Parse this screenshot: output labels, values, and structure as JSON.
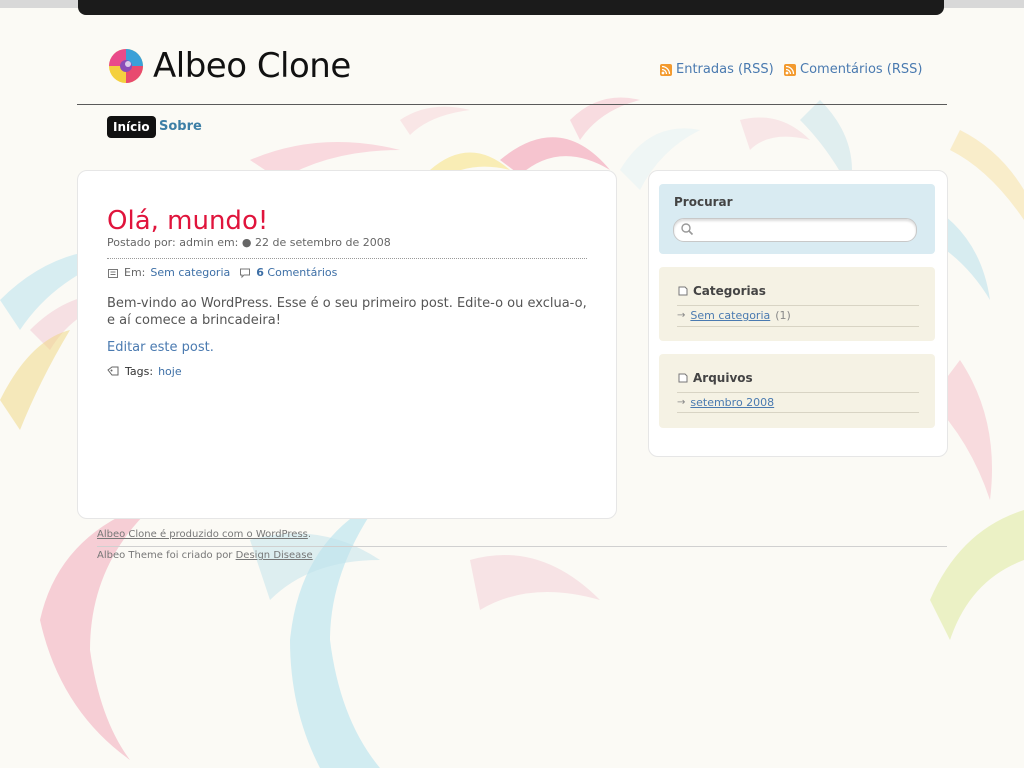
{
  "site": {
    "title": "Albeo Clone"
  },
  "header": {
    "rss_entries_label": "Entradas (RSS)",
    "rss_comments_label": "Comentários (RSS)"
  },
  "nav": {
    "active_label": "Início",
    "items": [
      "Sobre"
    ]
  },
  "post": {
    "title": "Olá, mundo!",
    "meta_prefix": "Postado por:",
    "author": "admin",
    "date_prefix": "em: ●",
    "date": "22 de setembro de 2008",
    "category_prefix": "Em:",
    "category": "Sem categoria",
    "comments_count": "6",
    "comments_label": "Comentários",
    "body": "Bem-vindo ao WordPress. Esse é o seu primeiro post. Edite-o ou exclua-o, e aí comece a brincadeira!",
    "edit_link": "Editar este post.",
    "tags_label": "Tags:",
    "tags": [
      "hoje"
    ]
  },
  "sidebar": {
    "search_title": "Procurar",
    "search_value": "",
    "categories_title": "Categorias",
    "categories": [
      {
        "label": "Sem categoria",
        "count": "(1)"
      }
    ],
    "archives_title": "Arquivos",
    "archives": [
      {
        "label": "setembro 2008"
      }
    ]
  },
  "footer": {
    "line1_link": "Albeo Clone é produzido com o WordPress",
    "line1_end": ".",
    "line2_prefix": "Albeo Theme foi criado por",
    "line2_link": "Design Disease"
  },
  "colors": {
    "accent_title": "#e0143c",
    "link": "#3d6fa6",
    "nav_active_bg": "#111111",
    "search_widget_bg": "#d9ebf2",
    "widget_bg": "#f5f2e4"
  }
}
